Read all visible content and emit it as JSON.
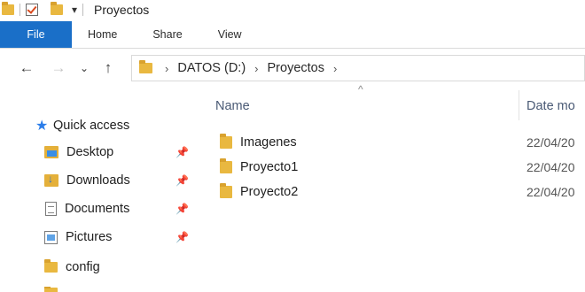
{
  "window": {
    "title": "Proyectos"
  },
  "ribbon": {
    "tabs": [
      "File",
      "Home",
      "Share",
      "View"
    ]
  },
  "address": {
    "segments": [
      "DATOS (D:)",
      "Proyectos"
    ]
  },
  "nav": {
    "quick_access": "Quick access",
    "items": [
      {
        "label": "Desktop",
        "icon": "desktop-folder-icon",
        "pinned": true
      },
      {
        "label": "Downloads",
        "icon": "downloads-folder-icon",
        "pinned": true
      },
      {
        "label": "Documents",
        "icon": "documents-icon",
        "pinned": true
      },
      {
        "label": "Pictures",
        "icon": "pictures-icon",
        "pinned": true
      },
      {
        "label": "config",
        "icon": "folder-icon",
        "pinned": false
      }
    ]
  },
  "columns": {
    "name": "Name",
    "date": "Date mo"
  },
  "files": [
    {
      "name": "Imagenes",
      "date": "22/04/20"
    },
    {
      "name": "Proyecto1",
      "date": "22/04/20"
    },
    {
      "name": "Proyecto2",
      "date": "22/04/20"
    }
  ],
  "colors": {
    "file_tab": "#1a6fc8",
    "folder": "#e9b840",
    "star": "#2b7de9"
  }
}
